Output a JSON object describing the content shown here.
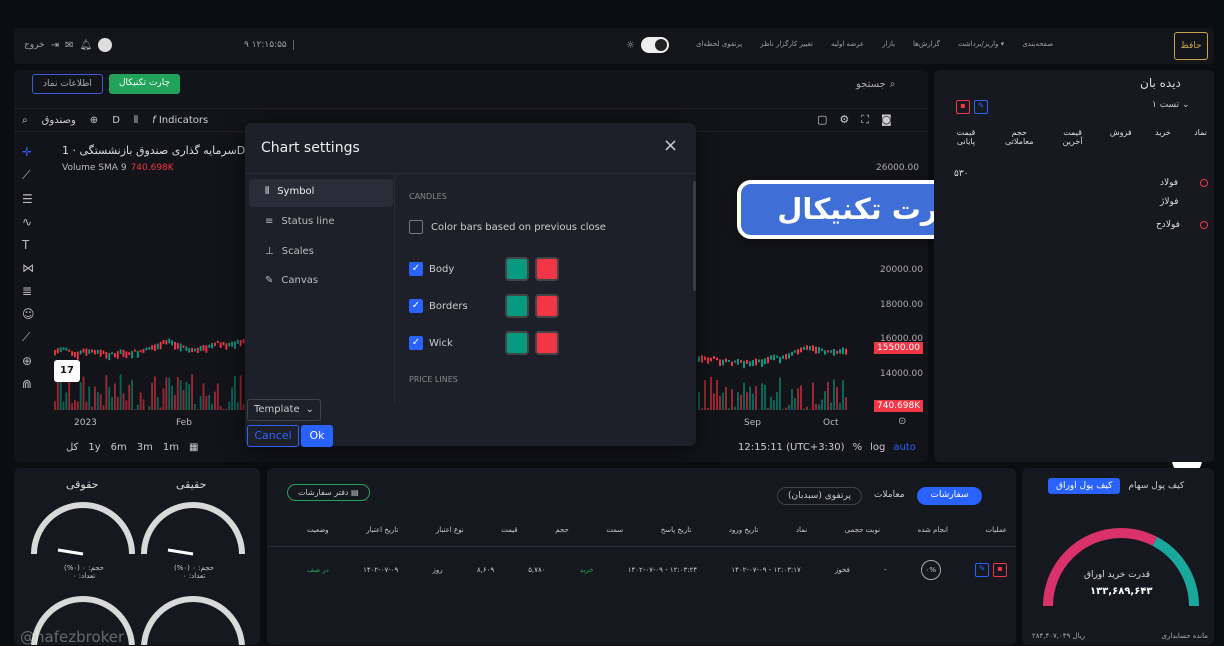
{
  "topbar": {
    "exit_label": "خروج",
    "clock": "۹ ۱۲:۱۵:۵۵",
    "menu": [
      "پرتفوی لحظه‌ای",
      "تغییر کارگزار ناظر",
      "عرضه اولیه",
      "بازار",
      "گزارش‌ها",
      "واریز/برداشت ▾",
      "صفحه‌بندی"
    ],
    "logo_text": "حافظ"
  },
  "chart_toolbar": {
    "tab_symbol_info": "اطلاعات نماد",
    "tab_technical": "چارت تکنیکال",
    "search_label": "جستجو",
    "symbol_search": "وصندوق",
    "interval": "D",
    "indicators": "Indicators"
  },
  "chart": {
    "title": "سرمایه گذاری صندوق بازنشستگی · 1D ·",
    "volume_label": "Volume SMA 9",
    "volume_value": "740.698K",
    "price_ticks": [
      "26000.00",
      "20000.00",
      "18000.00",
      "16000.00",
      "14000.00"
    ],
    "last_price": "15500.00",
    "volume_tag": "740.698K",
    "time_ticks": [
      "2023",
      "Feb",
      "Sep",
      "Oct"
    ],
    "periods": [
      "کل",
      "1y",
      "6m",
      "3m",
      "1m"
    ],
    "clock": "12:15:11 (UTC+3:30)",
    "percent": "%",
    "log": "log",
    "auto": "auto"
  },
  "dialog": {
    "title": "Chart settings",
    "nav": [
      "Symbol",
      "Status line",
      "Scales",
      "Canvas"
    ],
    "section_candles": "CANDLES",
    "color_prev_close": "Color bars based on previous close",
    "rows": [
      "Body",
      "Borders",
      "Wick"
    ],
    "section_price_lines": "PRICE LINES",
    "template": "Template",
    "cancel": "Cancel",
    "ok": "Ok",
    "up_color": "#089981",
    "down_color": "#f23645"
  },
  "banner": "تنظیمات چارت تکنیکال",
  "watch": {
    "title": "دیده بان",
    "list_name": "تست ۱",
    "headers": [
      "نماد",
      "خرید",
      "فروش",
      "قیمت آخرین",
      "حجم معاملاتی",
      "قیمت پایانی"
    ],
    "rows": [
      {
        "symbol": "فولاد",
        "last": "۵۳۰"
      },
      {
        "symbol": "فولاژ"
      },
      {
        "symbol": "فولادح"
      }
    ]
  },
  "gauges": {
    "labels": [
      "حقوقی",
      "حقیقی"
    ],
    "volume_text": "حجم: ۰ (۰%)",
    "count_text": "تعداد: ۰"
  },
  "orders": {
    "book_button": "دفتر سفارشات",
    "tabs": [
      "سفارشات",
      "معاملات",
      "پرتفوی (سبدبان)"
    ],
    "headers": [
      "عملیات",
      "انجام شده",
      "نوبت حجمی",
      "نماد",
      "تاریخ ورود",
      "تاریخ پاسخ",
      "سمت",
      "حجم",
      "قیمت",
      "نوع اعتبار",
      "تاریخ اعتبار",
      "وضعیت"
    ],
    "row": {
      "done": "۰%",
      "queue": "-",
      "symbol": "فخوز",
      "entry": "۱۴۰۲-۰۷-۰۹ - ۱۲:۰۳:۱۷",
      "response": "۱۴۰۲-۰۷-۰۹ - ۱۲:۰۳:۲۴",
      "side": "خرید",
      "volume": "۵,۷۸۰",
      "price": "۸,۶۰۹",
      "validity": "روز",
      "valid_date": "۱۴۰۲-۰۷-۰۹",
      "status": "در صف"
    }
  },
  "wallet": {
    "tabs": [
      "کیف پول سهام",
      "کیف پول اوراق"
    ],
    "power_label": "قدرت خرید اوراق",
    "power_value": "۱۳۳,۶۸۹,۶۴۳",
    "balance_label": "مانده حسابداری",
    "balance_value": "۲۸۴,۴۰۷,۰۴۹ ریال"
  },
  "watermark": "@hafezbroker"
}
